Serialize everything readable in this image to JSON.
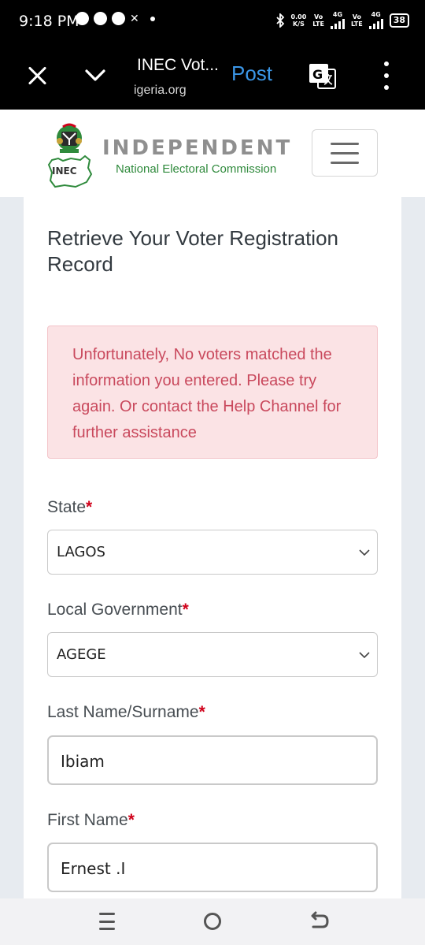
{
  "status_bar": {
    "time": "9:18 PM",
    "speed_value": "0.00",
    "speed_unit": "K/S",
    "net1_top": "Vo",
    "net1_bottom": "LTE",
    "net1_gen": "4G",
    "net2_top": "Vo",
    "net2_bottom": "LTE",
    "net2_gen": "4G",
    "battery": "38"
  },
  "browser": {
    "title": "INEC Vot...",
    "url": "igeria.org",
    "post_label": "Post"
  },
  "header": {
    "logo_text": "INEC",
    "title": "INDEPENDENT",
    "subtitle": "National Electoral Commission",
    "brand_green": "#2f8a3c"
  },
  "main": {
    "title": "Retrieve Your Voter Registration Record",
    "alert": "Unfortunately, No voters matched the information you entered. Please try again. Or contact the Help Channel for further assistance",
    "required_mark": "*",
    "fields": {
      "state": {
        "label": "State",
        "value": "LAGOS"
      },
      "lga": {
        "label": "Local Government",
        "value": "AGEGE"
      },
      "surname": {
        "label": "Last Name/Surname",
        "value": "Ibiam"
      },
      "first_name": {
        "label": "First Name",
        "value": "Ernest .I"
      }
    }
  },
  "colors": {
    "alert_bg": "#fbe3e5",
    "alert_text": "#c9495d",
    "link_blue": "#3b97e8",
    "required_red": "#d0021b"
  }
}
